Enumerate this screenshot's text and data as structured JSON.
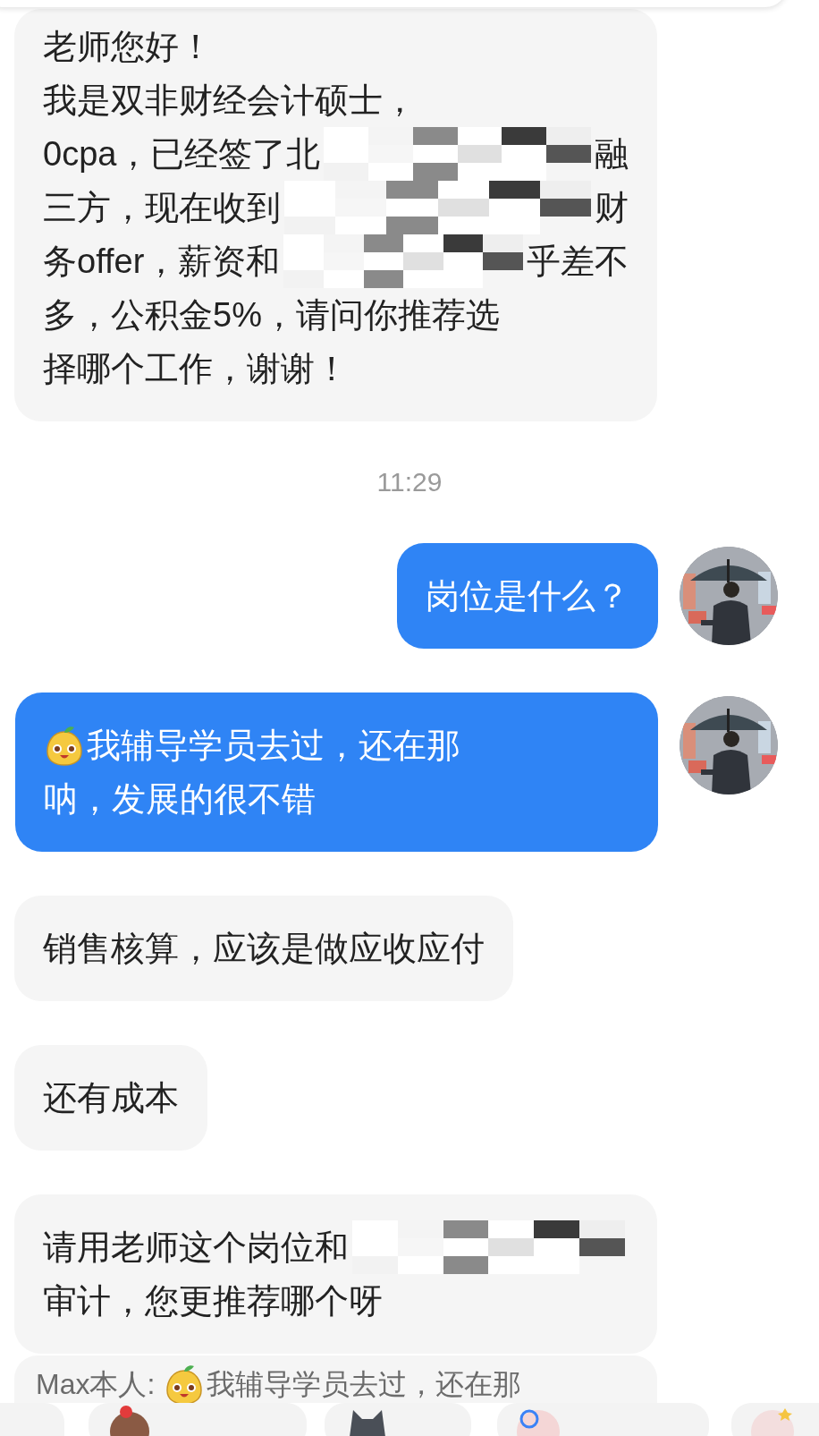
{
  "items": [
    {
      "kind": "received",
      "lines": [
        [
          {
            "kind": "text",
            "text": "老师您好！"
          }
        ],
        [
          {
            "kind": "text",
            "text": "我是双非财经会计硕士，"
          }
        ],
        [
          {
            "kind": "text",
            "text": "0cpa，已经签了北"
          },
          {
            "kind": "mosaic"
          },
          {
            "kind": "text",
            "text": "融"
          }
        ],
        [
          {
            "kind": "text",
            "text": "三方，现在收到"
          },
          {
            "kind": "mosaic"
          },
          {
            "kind": "text",
            "text": "财"
          }
        ],
        [
          {
            "kind": "text",
            "text": "务offer，薪资和"
          },
          {
            "kind": "mosaic"
          },
          {
            "kind": "text",
            "text": "乎差不"
          }
        ],
        [
          {
            "kind": "text",
            "text": "多，公积金5%，请问你推荐选"
          }
        ],
        [
          {
            "kind": "text",
            "text": "择哪个工作，谢谢！"
          }
        ]
      ]
    },
    {
      "kind": "time",
      "text": "11:29"
    },
    {
      "kind": "sent",
      "lines": [
        [
          {
            "kind": "text",
            "text": "岗位是什么？"
          }
        ]
      ]
    },
    {
      "kind": "sent",
      "lines": [
        [
          {
            "kind": "emoji"
          },
          {
            "kind": "text",
            "text": "我辅导学员去过，还在那"
          }
        ],
        [
          {
            "kind": "text",
            "text": "呐，发展的很不错"
          }
        ]
      ]
    },
    {
      "kind": "received",
      "lines": [
        [
          {
            "kind": "text",
            "text": "销售核算，应该是做应收应付"
          }
        ]
      ]
    },
    {
      "kind": "received",
      "lines": [
        [
          {
            "kind": "text",
            "text": "还有成本"
          }
        ]
      ]
    },
    {
      "kind": "received",
      "lines": [
        [
          {
            "kind": "text",
            "text": "请用老师这个岗位和"
          },
          {
            "kind": "mosaic"
          }
        ],
        [
          {
            "kind": "text",
            "text": "审计，您更推荐哪个呀"
          }
        ]
      ]
    }
  ],
  "quote": {
    "author": "Max本人:",
    "segments": [
      {
        "kind": "emoji"
      },
      {
        "kind": "text",
        "text": "我辅导学员去过，还在那"
      }
    ]
  }
}
